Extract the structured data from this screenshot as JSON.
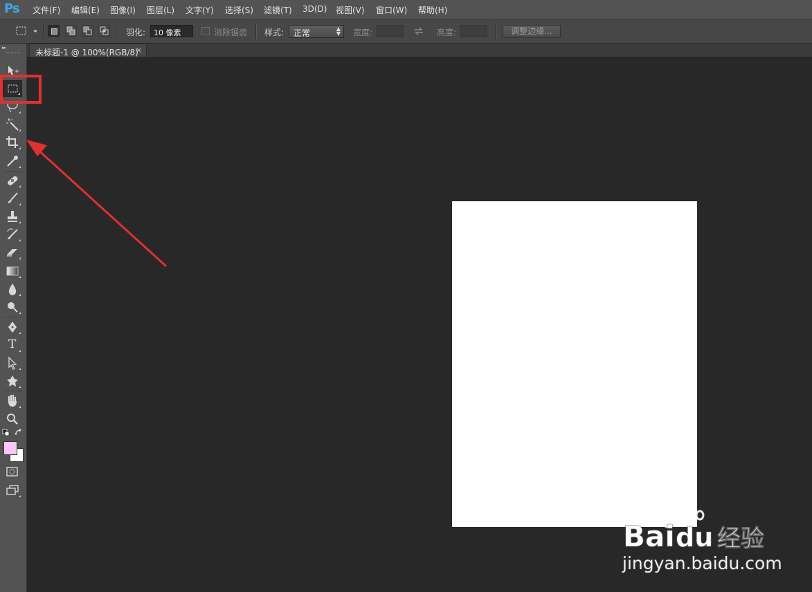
{
  "app": {
    "logo": "Ps"
  },
  "menu": [
    "文件(F)",
    "编辑(E)",
    "图像(I)",
    "图层(L)",
    "文字(Y)",
    "选择(S)",
    "滤镜(T)",
    "3D(D)",
    "视图(V)",
    "窗口(W)",
    "帮助(H)"
  ],
  "options": {
    "feather_label": "羽化:",
    "feather_value": "10 像素",
    "antialias_label": "消除锯齿",
    "style_label": "样式:",
    "style_value": "正常",
    "width_label": "宽度:",
    "height_label": "高度:",
    "refine_edge_label": "调整边缘..."
  },
  "document": {
    "tab_title": "未标题-1 @ 100%(RGB/8)",
    "close_glyph": "×"
  },
  "colors": {
    "foreground": "#f7c9f4",
    "background": "#ffffff",
    "annotation": "#e03131"
  },
  "toolbar": {
    "tools": [
      "move-tool",
      "rectangular-marquee-tool",
      "lasso-tool",
      "magic-wand-tool",
      "crop-tool",
      "eyedropper-tool",
      "spot-healing-brush-tool",
      "brush-tool",
      "clone-stamp-tool",
      "history-brush-tool",
      "eraser-tool",
      "gradient-tool",
      "blur-tool",
      "dodge-tool",
      "pen-tool",
      "type-tool",
      "path-selection-tool",
      "custom-shape-tool",
      "hand-tool",
      "zoom-tool"
    ],
    "active_tool": "rectangular-marquee-tool",
    "type_tool_glyph": "T"
  },
  "watermark": {
    "brand_left": "Bai",
    "brand_right": "du",
    "brand_cn": "经验",
    "url": "jingyan.baidu.com"
  }
}
